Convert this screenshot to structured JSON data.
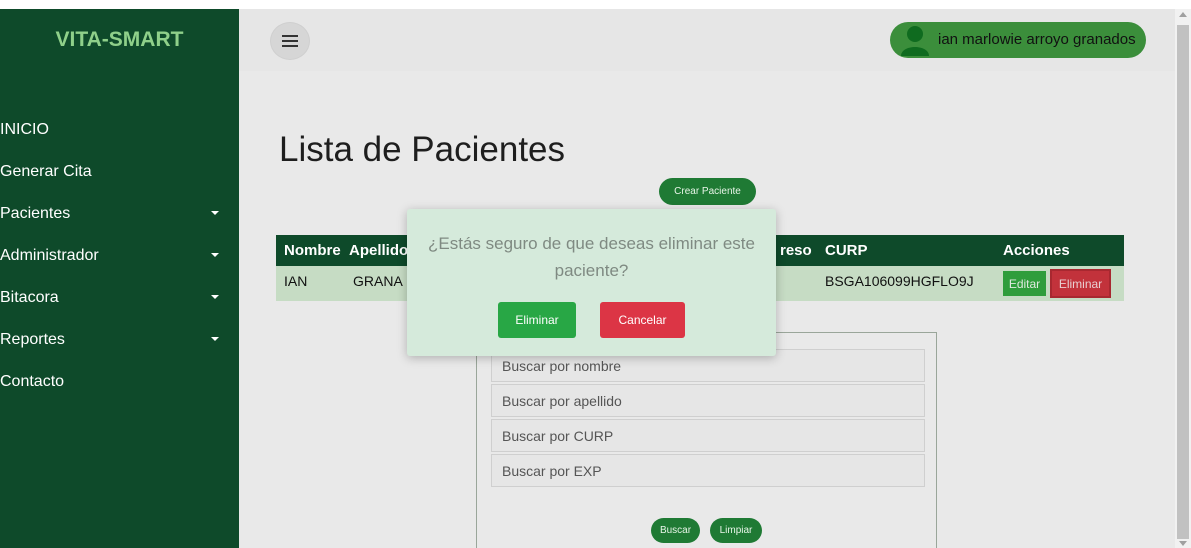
{
  "sidebar": {
    "brand": "VITA-SMART",
    "items": [
      {
        "label": "INICIO",
        "has_caret": false
      },
      {
        "label": "Generar Cita",
        "has_caret": false
      },
      {
        "label": "Pacientes",
        "has_caret": true
      },
      {
        "label": "Administrador",
        "has_caret": true
      },
      {
        "label": "Bitacora",
        "has_caret": true
      },
      {
        "label": "Reportes",
        "has_caret": true
      },
      {
        "label": "Contacto",
        "has_caret": false
      }
    ]
  },
  "header": {
    "menu_icon": "hamburger-menu-icon",
    "user_icon": "user-avatar-icon",
    "user_name": "ian marlowie arroyo granados"
  },
  "main": {
    "title": "Lista de Pacientes",
    "create_button": "Crear Paciente",
    "table": {
      "headers": [
        "Nombre",
        "Apellido",
        "reso",
        "CURP",
        "Acciones"
      ],
      "rows": [
        {
          "nombre": "IAN",
          "apellido": "GRANA",
          "curp": "BSGA106099HGFLO9J"
        }
      ],
      "edit_label": "Editar",
      "delete_label": "Eliminar"
    },
    "search": {
      "nombre_placeholder": "Buscar por nombre",
      "apellido_placeholder": "Buscar por apellido",
      "curp_placeholder": "Buscar por CURP",
      "exp_placeholder": "Buscar por EXP",
      "search_button": "Buscar",
      "clear_button": "Limpiar"
    }
  },
  "modal": {
    "message": "¿Estás seguro de que deseas eliminar este paciente?",
    "confirm_button": "Eliminar",
    "cancel_button": "Cancelar"
  },
  "colors": {
    "sidebar_bg": "#0e4a2a",
    "brand_text": "#8fd08a",
    "accent_green": "#28a745",
    "danger_red": "#dc3545",
    "modal_bg": "#d5eadb"
  }
}
